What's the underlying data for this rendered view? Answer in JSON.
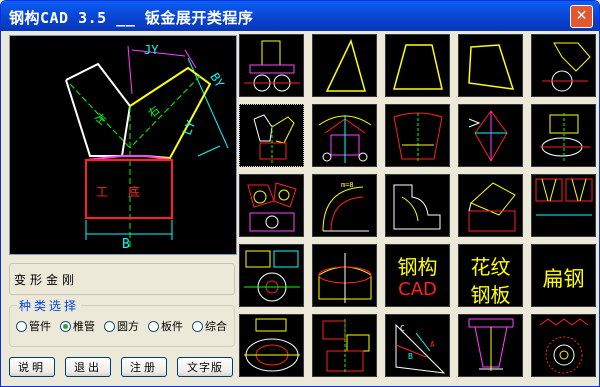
{
  "window": {
    "title": "钢构CAD 3.5 __ 钣金展开类程序",
    "close_glyph": "✕"
  },
  "preview": {
    "label_jy": "JY",
    "label_by": "BY",
    "label_ly": "LY",
    "label_b": "B",
    "label_left": "左",
    "label_right": "右",
    "label_body": "工 底"
  },
  "component_name": "变形金刚",
  "category": {
    "legend": "种类选择",
    "options": [
      "管件",
      "椎管",
      "圆方",
      "板件",
      "综合"
    ],
    "selected": "椎管"
  },
  "buttons": {
    "help": "说明",
    "exit": "退出",
    "register": "注册",
    "text_version": "文字版"
  },
  "thumbnails": {
    "text_tiles": [
      {
        "line1": "钢构",
        "line2": "CAD",
        "color1": "#ffff00",
        "color2": "#ff2020"
      },
      {
        "line1": "花纹",
        "line2": "钢板",
        "color1": "#ffff00",
        "color2": "#ffff00"
      },
      {
        "line1": "扁钢",
        "line2": "",
        "color1": "#ffff00",
        "color2": "#ffff00"
      }
    ]
  }
}
